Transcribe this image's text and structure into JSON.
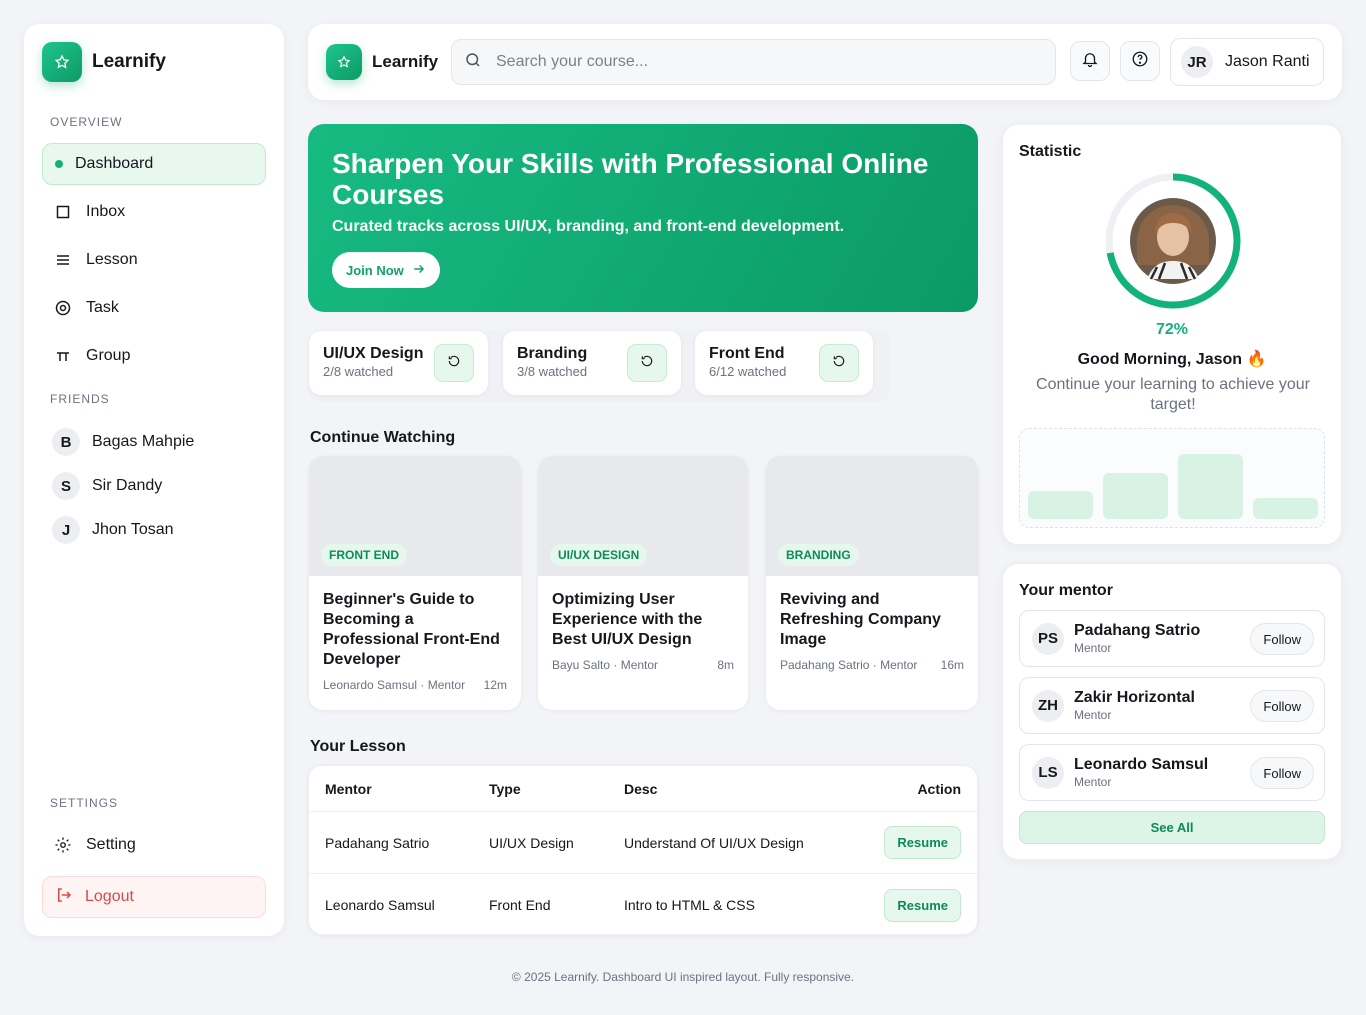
{
  "app": {
    "name": "Learnify"
  },
  "colors": {
    "accent": "#12b37a",
    "accent_light": "#e6f8ee",
    "danger": "#e04646"
  },
  "sidebar": {
    "overview_label": "OVERVIEW",
    "nav": [
      {
        "label": "Dashboard",
        "icon": "dot-icon",
        "active": true
      },
      {
        "label": "Inbox",
        "icon": "inbox-icon"
      },
      {
        "label": "Lesson",
        "icon": "list-icon"
      },
      {
        "label": "Task",
        "icon": "task-icon"
      },
      {
        "label": "Group",
        "icon": "group-icon"
      }
    ],
    "friends_label": "FRIENDS",
    "friends": [
      {
        "initial": "B",
        "name": "Bagas Mahpie"
      },
      {
        "initial": "S",
        "name": "Sir Dandy"
      },
      {
        "initial": "J",
        "name": "Jhon Tosan"
      }
    ],
    "settings_label": "SETTINGS",
    "setting": "Setting",
    "logout": "Logout"
  },
  "header": {
    "search_placeholder": "Search your course...",
    "user_initials": "JR",
    "user_name": "Jason Ranti"
  },
  "hero": {
    "title": "Sharpen Your Skills with Professional Online Courses",
    "subtitle": "Curated tracks across UI/UX, branding, and front-end development.",
    "cta": "Join Now"
  },
  "progress_cards": [
    {
      "title": "UI/UX Design",
      "sub": "2/8 watched"
    },
    {
      "title": "Branding",
      "sub": "3/8 watched"
    },
    {
      "title": "Front End",
      "sub": "6/12 watched"
    }
  ],
  "continue_watching": {
    "title": "Continue Watching",
    "cards": [
      {
        "tag": "FRONT END",
        "title": "Beginner's Guide to Becoming a Professional Front-End Developer",
        "mentor": "Leonardo Samsul · Mentor",
        "duration": "12m"
      },
      {
        "tag": "UI/UX DESIGN",
        "title": "Optimizing User Experience with the Best UI/UX Design",
        "mentor": "Bayu Salto · Mentor",
        "duration": "8m"
      },
      {
        "tag": "BRANDING",
        "title": "Reviving and Refreshing Company Image",
        "mentor": "Padahang Satrio · Mentor",
        "duration": "16m"
      }
    ]
  },
  "lessons": {
    "title": "Your Lesson",
    "headers": {
      "mentor": "Mentor",
      "type": "Type",
      "desc": "Desc",
      "action": "Action"
    },
    "rows": [
      {
        "mentor": "Padahang Satrio",
        "type": "UI/UX Design",
        "desc": "Understand Of UI/UX Design",
        "action": "Resume"
      },
      {
        "mentor": "Leonardo Samsul",
        "type": "Front End",
        "desc": "Intro to HTML & CSS",
        "action": "Resume"
      }
    ]
  },
  "statistic": {
    "title": "Statistic",
    "progress": 0.72,
    "percent_label": "72%",
    "greeting": "Good Morning, Jason 🔥",
    "message": "Continue your learning to achieve your target!",
    "bars": [
      0.33,
      0.55,
      0.77,
      0.25
    ]
  },
  "mentors": {
    "title": "Your mentor",
    "list": [
      {
        "initials": "PS",
        "name": "Padahang Satrio",
        "role": "Mentor",
        "action": "Follow"
      },
      {
        "initials": "ZH",
        "name": "Zakir Horizontal",
        "role": "Mentor",
        "action": "Follow"
      },
      {
        "initials": "LS",
        "name": "Leonardo Samsul",
        "role": "Mentor",
        "action": "Follow"
      }
    ],
    "see_all": "See All"
  },
  "footer": "© 2025 Learnify. Dashboard UI inspired layout. Fully responsive."
}
